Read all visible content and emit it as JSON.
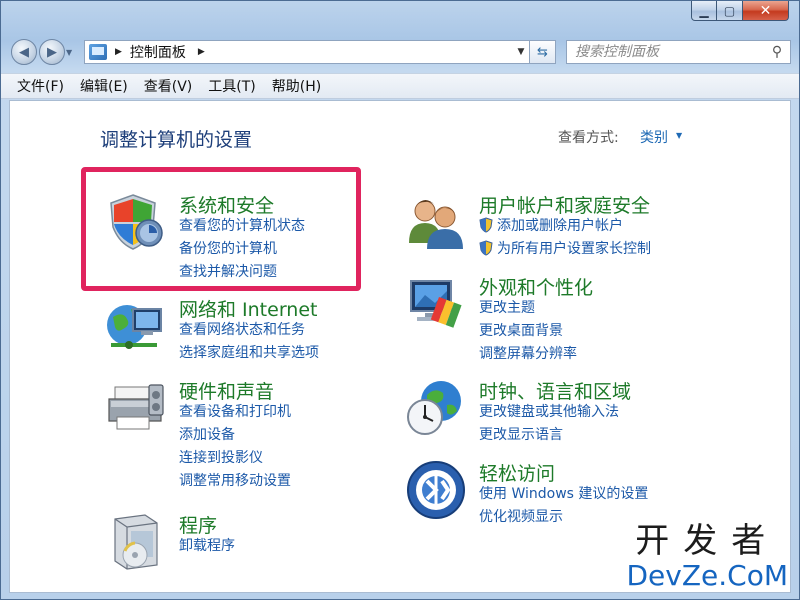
{
  "window": {
    "caption": {
      "minimize": "▁",
      "maximize": "▢",
      "close": "✕"
    }
  },
  "navbar": {
    "back_glyph": "◀",
    "forward_glyph": "▶",
    "address_crumb": "控制面板",
    "search_placeholder": "搜索控制面板"
  },
  "menu": [
    {
      "label": "文件(F)"
    },
    {
      "label": "编辑(E)"
    },
    {
      "label": "查看(V)"
    },
    {
      "label": "工具(T)"
    },
    {
      "label": "帮助(H)"
    }
  ],
  "content": {
    "heading": "调整计算机的设置",
    "view_label": "查看方式:",
    "view_value": "类别"
  },
  "categories": {
    "system": {
      "title": "系统和安全",
      "links": [
        "查看您的计算机状态",
        "备份您的计算机",
        "查找并解决问题"
      ]
    },
    "network": {
      "title": "网络和 Internet",
      "links": [
        "查看网络状态和任务",
        "选择家庭组和共享选项"
      ]
    },
    "hardware": {
      "title": "硬件和声音",
      "links": [
        "查看设备和打印机",
        "添加设备",
        "连接到投影仪",
        "调整常用移动设置"
      ]
    },
    "programs": {
      "title": "程序",
      "links": [
        "卸载程序"
      ]
    },
    "users": {
      "title": "用户帐户和家庭安全",
      "links": [
        "添加或删除用户帐户",
        "为所有用户设置家长控制"
      ]
    },
    "appearance": {
      "title": "外观和个性化",
      "links": [
        "更改主题",
        "更改桌面背景",
        "调整屏幕分辨率"
      ]
    },
    "clock": {
      "title": "时钟、语言和区域",
      "links": [
        "更改键盘或其他输入法",
        "更改显示语言"
      ]
    },
    "access": {
      "title": "轻松访问",
      "links": [
        "使用 Windows 建议的设置",
        "优化视频显示"
      ]
    }
  },
  "watermark": {
    "top": "开发者",
    "bottom": "DevZe.CoM"
  }
}
